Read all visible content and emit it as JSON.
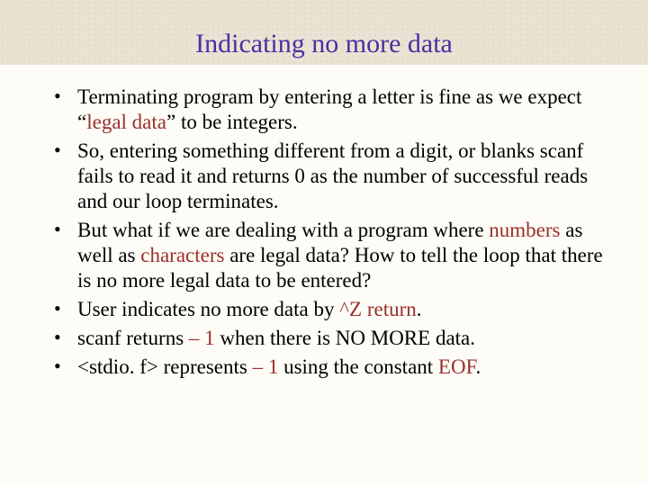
{
  "title": "Indicating no more data",
  "bullets": [
    {
      "pre1": "Terminating program by entering a letter is fine as we expect “",
      "hl1": "legal data",
      "post1": "” to be integers."
    },
    {
      "plain": "So, entering something different from a digit, or blanks scanf fails to read it and returns 0 as the number of successful reads and our loop terminates."
    },
    {
      "pre1": "But what if we are dealing with a program where ",
      "hl1": "numbers",
      "mid1": " as well as ",
      "hl2": "characters",
      "post1": " are legal data? How to tell the loop that there is no more legal data to be entered?"
    },
    {
      "pre1": "User indicates no more data by ",
      "hl1": "^Z return",
      "post1": "."
    },
    {
      "pre1": "scanf returns ",
      "hl1": "– 1",
      "post1": " when there is NO MORE data."
    },
    {
      "pre1": "<stdio. f> represents ",
      "hl1": "– 1",
      "mid1": " using the constant ",
      "hl2": "EOF",
      "post1": "."
    }
  ]
}
